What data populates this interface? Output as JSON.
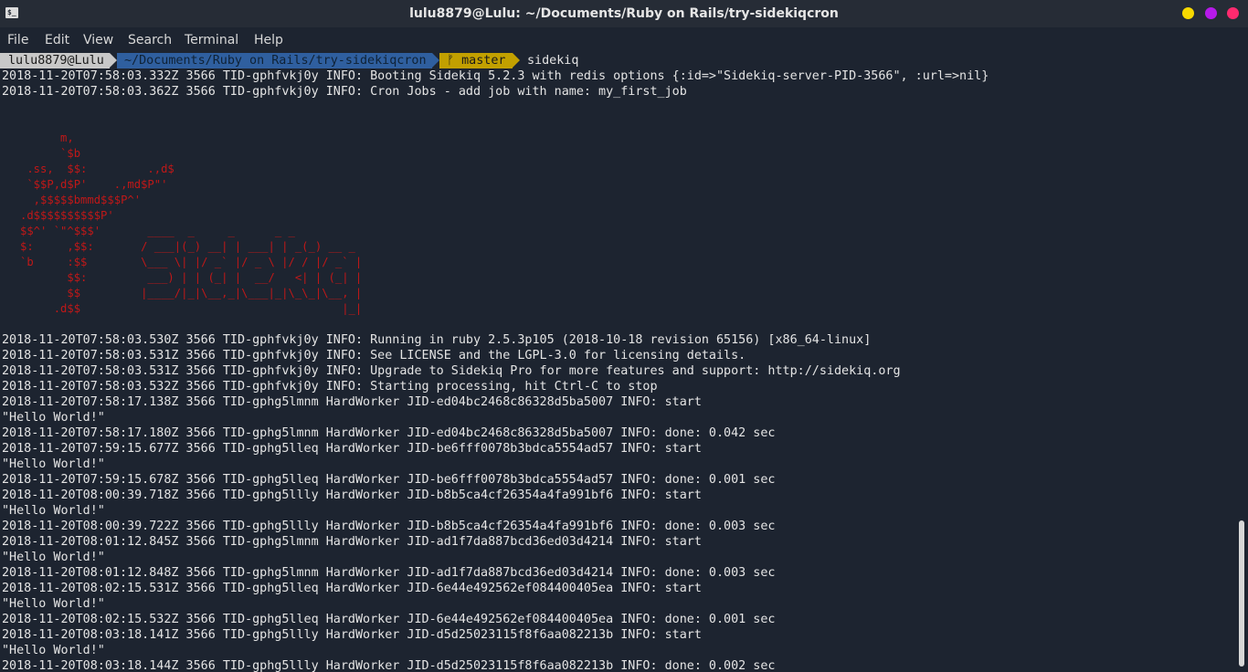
{
  "window": {
    "title": "lulu8879@Lulu: ~/Documents/Ruby on Rails/try-sidekiqcron",
    "app_icon_glyph": "$_",
    "buttons": {
      "minimize_color": "#f7d900",
      "maximize_color": "#b61aea",
      "close_color": "#ff2a6f"
    }
  },
  "menu": {
    "file": "File",
    "edit": "Edit",
    "view": "View",
    "search": "Search",
    "terminal": "Terminal",
    "help": "Help"
  },
  "prompt": {
    "user_host": "lulu8879@Lulu",
    "path": "~/Documents/Ruby on Rails/try-sidekiqcron",
    "branch": "ᚠ master",
    "command": "sidekiq"
  },
  "log_top": [
    "2018-11-20T07:58:03.332Z 3566 TID-gphfvkj0y INFO: Booting Sidekiq 5.2.3 with redis options {:id=>\"Sidekiq-server-PID-3566\", :url=>nil}",
    "2018-11-20T07:58:03.362Z 3566 TID-gphfvkj0y INFO: Cron Jobs - add job with name: my_first_job"
  ],
  "ascii_art": "         m,\n         `$b\n    .ss,  $$:         .,d$\n    `$$P,d$P'    .,md$P\"'\n     ,$$$$$bmmd$$$P^'\n   .d$$$$$$$$$$P'\n   $$^' `\"^$$$'       ____  _     _      _ _\n   $:     ,$$:       / ___|(_) __| | ___| | _(_) __ _\n   `b     :$$        \\___ \\| |/ _` |/ _ \\ |/ / |/ _` |\n          $$:         ___) | | (_| |  __/   <| | (_| |\n          $$         |____/|_|\\__,_|\\___|_|\\_\\_|\\__, |\n        .d$$                                       |_|",
  "log_bottom": [
    "2018-11-20T07:58:03.530Z 3566 TID-gphfvkj0y INFO: Running in ruby 2.5.3p105 (2018-10-18 revision 65156) [x86_64-linux]",
    "2018-11-20T07:58:03.531Z 3566 TID-gphfvkj0y INFO: See LICENSE and the LGPL-3.0 for licensing details.",
    "2018-11-20T07:58:03.531Z 3566 TID-gphfvkj0y INFO: Upgrade to Sidekiq Pro for more features and support: http://sidekiq.org",
    "2018-11-20T07:58:03.532Z 3566 TID-gphfvkj0y INFO: Starting processing, hit Ctrl-C to stop",
    "2018-11-20T07:58:17.138Z 3566 TID-gphg5lmnm HardWorker JID-ed04bc2468c86328d5ba5007 INFO: start",
    "\"Hello World!\"",
    "2018-11-20T07:58:17.180Z 3566 TID-gphg5lmnm HardWorker JID-ed04bc2468c86328d5ba5007 INFO: done: 0.042 sec",
    "2018-11-20T07:59:15.677Z 3566 TID-gphg5lleq HardWorker JID-be6fff0078b3bdca5554ad57 INFO: start",
    "\"Hello World!\"",
    "2018-11-20T07:59:15.678Z 3566 TID-gphg5lleq HardWorker JID-be6fff0078b3bdca5554ad57 INFO: done: 0.001 sec",
    "2018-11-20T08:00:39.718Z 3566 TID-gphg5llly HardWorker JID-b8b5ca4cf26354a4fa991bf6 INFO: start",
    "\"Hello World!\"",
    "2018-11-20T08:00:39.722Z 3566 TID-gphg5llly HardWorker JID-b8b5ca4cf26354a4fa991bf6 INFO: done: 0.003 sec",
    "2018-11-20T08:01:12.845Z 3566 TID-gphg5lmnm HardWorker JID-ad1f7da887bcd36ed03d4214 INFO: start",
    "\"Hello World!\"",
    "2018-11-20T08:01:12.848Z 3566 TID-gphg5lmnm HardWorker JID-ad1f7da887bcd36ed03d4214 INFO: done: 0.003 sec",
    "2018-11-20T08:02:15.531Z 3566 TID-gphg5lleq HardWorker JID-6e44e492562ef084400405ea INFO: start",
    "\"Hello World!\"",
    "2018-11-20T08:02:15.532Z 3566 TID-gphg5lleq HardWorker JID-6e44e492562ef084400405ea INFO: done: 0.001 sec",
    "2018-11-20T08:03:18.141Z 3566 TID-gphg5llly HardWorker JID-d5d25023115f8f6aa082213b INFO: start",
    "\"Hello World!\"",
    "2018-11-20T08:03:18.144Z 3566 TID-gphg5llly HardWorker JID-d5d25023115f8f6aa082213b INFO: done: 0.002 sec"
  ],
  "colors": {
    "background": "#1d2430",
    "ascii_art": "#c01818",
    "prompt_user_bg": "#c8c8c8",
    "prompt_path_bg": "#2f5f9f",
    "prompt_git_bg": "#c2a000"
  }
}
